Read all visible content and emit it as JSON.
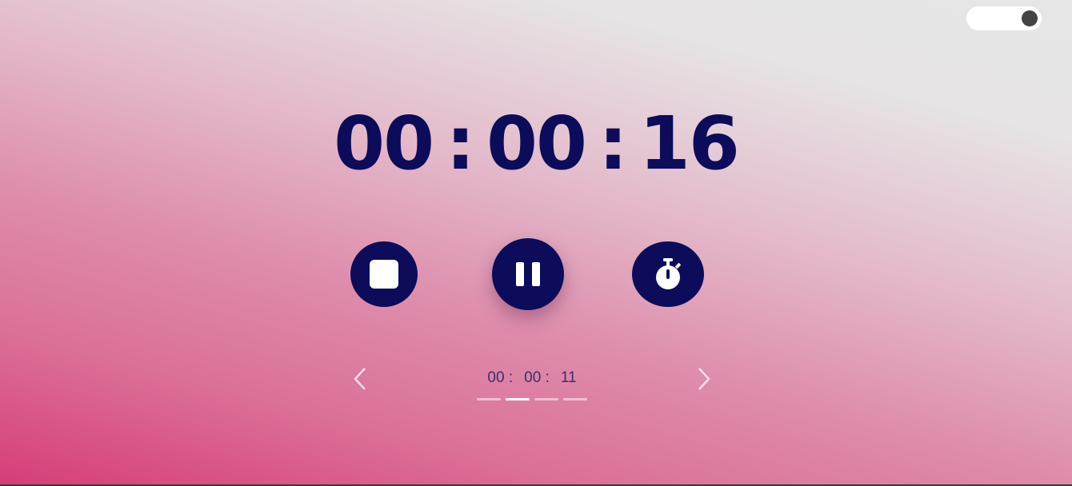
{
  "theme_toggle": {
    "state": "on",
    "knob_color": "#444444"
  },
  "timer": {
    "hours": "00",
    "minutes": "00",
    "seconds": "16",
    "separator": ":",
    "color": "#0c0c5a"
  },
  "controls": [
    {
      "name": "stop",
      "icon": "stop-icon"
    },
    {
      "name": "pause",
      "icon": "pause-icon"
    },
    {
      "name": "lap",
      "icon": "stopwatch-icon"
    }
  ],
  "lap_history": {
    "hours": "00",
    "minutes": "00",
    "seconds": "11",
    "separator": ":",
    "prev_icon": "chevron-left-icon",
    "next_icon": "chevron-right-icon",
    "pages": 4,
    "active_page_index": 1
  },
  "colors": {
    "accent": "#0c0c5a",
    "gradient_start": "#e6e6e6",
    "gradient_end": "#d63d78"
  }
}
